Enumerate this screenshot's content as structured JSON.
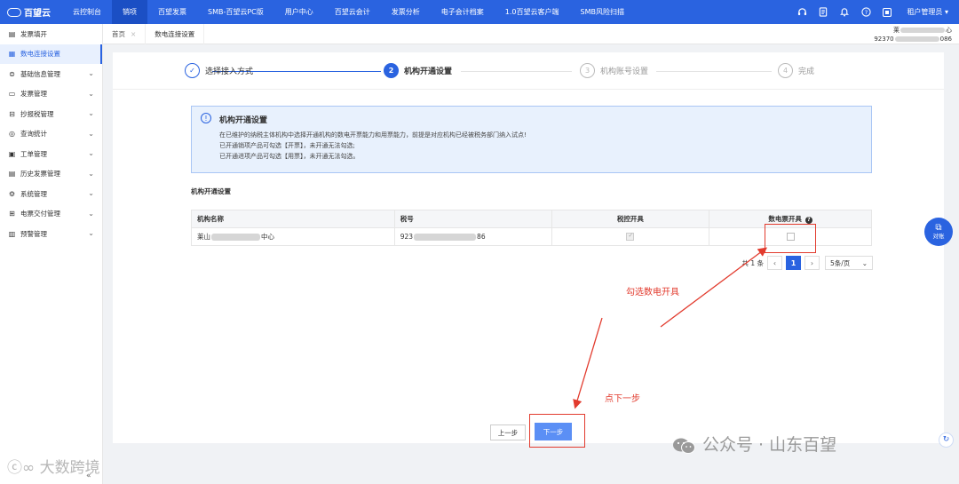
{
  "app": {
    "logo_text": "百望云"
  },
  "topnav": {
    "items": [
      "云控制台",
      "销项",
      "百望发票",
      "SMB-百望云PC版",
      "用户中心",
      "百望云会计",
      "发票分析",
      "电子会计档案",
      "1.0百望云客户端",
      "SMB风险扫描"
    ],
    "active_index": 1,
    "user_label": "租户管理员"
  },
  "sidebar": {
    "items": [
      {
        "label": "发票填开",
        "has_children": false
      },
      {
        "label": "数电连接设置",
        "has_children": false,
        "active": true
      },
      {
        "label": "基础信息管理",
        "has_children": true
      },
      {
        "label": "发票管理",
        "has_children": true
      },
      {
        "label": "抄报税管理",
        "has_children": true
      },
      {
        "label": "查询统计",
        "has_children": true
      },
      {
        "label": "工单管理",
        "has_children": true
      },
      {
        "label": "历史发票管理",
        "has_children": true
      },
      {
        "label": "系统管理",
        "has_children": true
      },
      {
        "label": "电票交付管理",
        "has_children": true
      },
      {
        "label": "预警管理",
        "has_children": true
      }
    ],
    "collapse_glyph": "«"
  },
  "tabs": {
    "home": "首页",
    "current": "数电连接设置"
  },
  "org_header": {
    "line1_prefix": "莱",
    "line1_suffix": "心",
    "line2_prefix": "92370",
    "line2_suffix": "086"
  },
  "steps": [
    {
      "num": "✓",
      "label": "选择接入方式",
      "state": "done"
    },
    {
      "num": "2",
      "label": "机构开通设置",
      "state": "active"
    },
    {
      "num": "3",
      "label": "机构账号设置",
      "state": "pending"
    },
    {
      "num": "4",
      "label": "完成",
      "state": "pending"
    }
  ],
  "notice": {
    "title": "机构开通设置",
    "lines": [
      "在已维护的纳税主体机构中选择开通机构的数电开票能力和用票能力，前提是对应机构已经被税务部门纳入试点!",
      "已开通销项产品可勾选【开票】，未开通无法勾选;",
      "已开通进项产品可勾选【用票】，未开通无法勾选。"
    ]
  },
  "section_title": "机构开通设置",
  "table": {
    "headers": [
      "机构名称",
      "税号",
      "税控开具",
      "数电票开具"
    ],
    "rows": [
      {
        "org_prefix": "莱山",
        "org_suffix": "中心",
        "tax_prefix": "923",
        "tax_suffix": "86",
        "tax_control_checked": true,
        "digital_checked": false
      }
    ]
  },
  "pager": {
    "total_text": "共 1 条",
    "current_page": "1",
    "page_size": "5条/页"
  },
  "annotations": {
    "check_hint": "勾选数电开具",
    "next_hint": "点下一步"
  },
  "buttons": {
    "prev": "上一步",
    "next": "下一步"
  },
  "service_label": "对账",
  "watermark": {
    "right": "公众号 · 山东百望",
    "left": "大数跨境"
  },
  "colors": {
    "brand": "#2a63e0",
    "annotation": "#e23b2e",
    "notice_bg": "#e8f1fd"
  }
}
